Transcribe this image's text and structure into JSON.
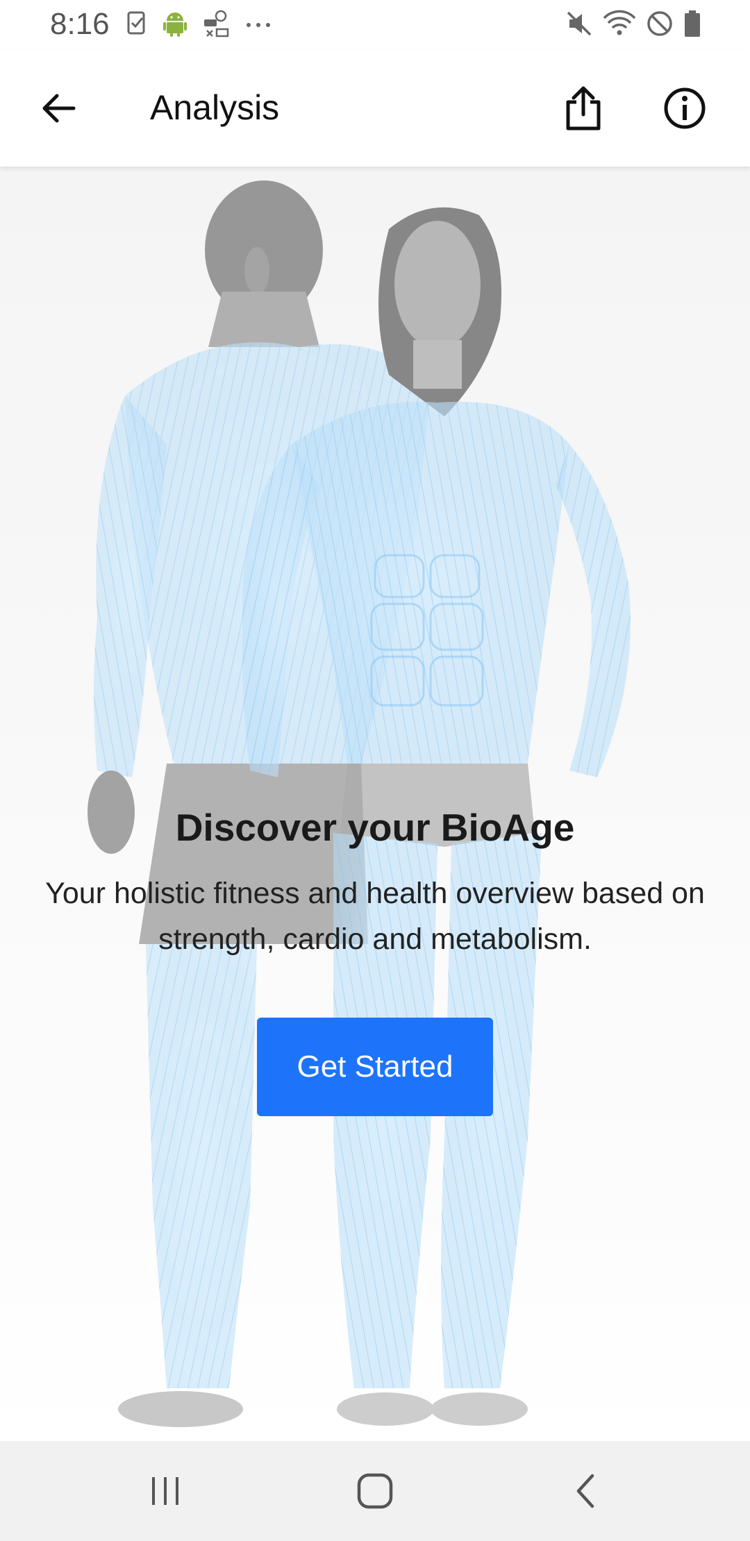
{
  "status_bar": {
    "time": "8:16",
    "left_icons": [
      "task-check-icon",
      "android-icon",
      "money-transfer-icon",
      "more-dots-icon"
    ],
    "right_icons": [
      "mute-icon",
      "wifi-icon",
      "do-not-disturb-icon",
      "battery-icon"
    ]
  },
  "app_bar": {
    "title": "Analysis",
    "back_icon": "back-arrow-icon",
    "share_icon": "share-icon",
    "info_icon": "info-icon"
  },
  "hero": {
    "illustration": "muscle-anatomy-figures",
    "title": "Discover your BioAge",
    "subtitle": "Your holistic fitness and health overview based on strength, cardio and metabolism.",
    "button_label": "Get Started"
  },
  "nav_bar": {
    "recent_icon": "recent-apps-icon",
    "home_icon": "home-icon",
    "back_icon": "nav-back-icon"
  },
  "colors": {
    "accent": "#1d74fb",
    "muscle_blue": "#9fd0f5",
    "body_gray": "#8a8a8a",
    "nav_bar_bg": "#f1f1f1"
  }
}
